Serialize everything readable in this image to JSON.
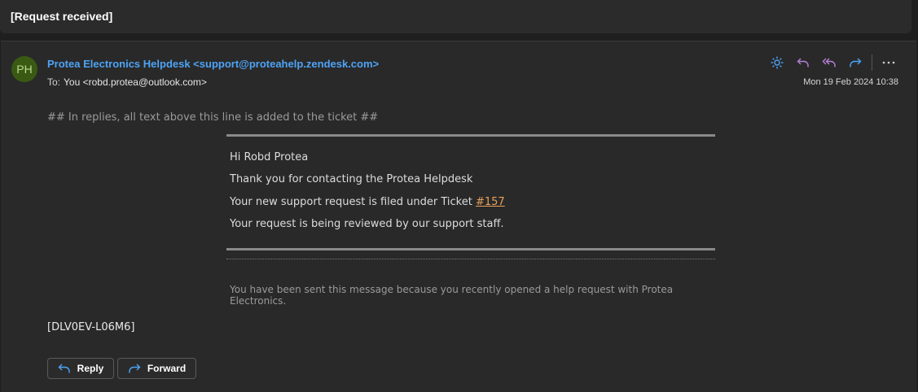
{
  "subject": "[Request received]",
  "message": {
    "avatar_initials": "PH",
    "avatar_color": "#3a5a14",
    "sender": "Protea Electronics Helpdesk <support@proteahelp.zendesk.com>",
    "to_label": "To:",
    "to_value": "You <robd.protea@outlook.com>",
    "date": "Mon 19 Feb 2024 10:38",
    "actions": [
      "sun-icon",
      "reply-icon",
      "reply-all-icon",
      "forward-icon",
      "more-icon"
    ]
  },
  "body": {
    "delimiter": "## In replies, all text above this line is added to the ticket ##",
    "greeting": "Hi Robd Protea",
    "thanks": "Thank you for contacting the Protea Helpdesk",
    "ticket_prefix": "Your new support request is filed under Ticket ",
    "ticket_link": "#157",
    "review": "Your request is being reviewed by our support staff.",
    "footer_note": "You have been sent this message because you recently opened a help request with Protea Electronics.",
    "reference": "[DLV0EV-L06M6]"
  },
  "buttons": {
    "reply": "Reply",
    "forward": "Forward"
  }
}
